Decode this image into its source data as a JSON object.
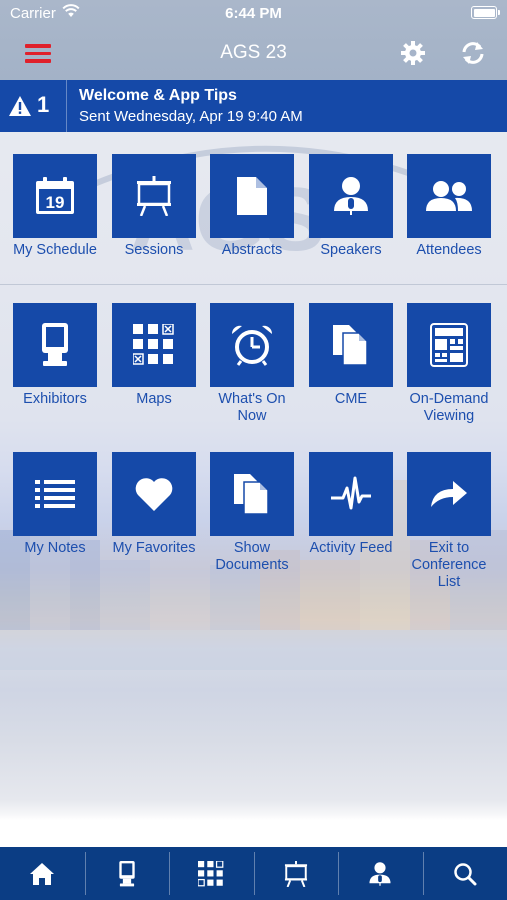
{
  "status_bar": {
    "carrier": "Carrier",
    "time": "6:44 PM"
  },
  "nav": {
    "title": "AGS 23",
    "accent_color": "#e0202b"
  },
  "alert": {
    "count": "1",
    "title": "Welcome & App Tips",
    "subtitle": "Sent Wednesday, Apr 19 9:40 AM",
    "color": "#1549a8"
  },
  "tiles": [
    {
      "label": "My Schedule",
      "icon": "calendar-icon"
    },
    {
      "label": "Sessions",
      "icon": "easel-icon"
    },
    {
      "label": "Abstracts",
      "icon": "document-icon"
    },
    {
      "label": "Speakers",
      "icon": "speaker-icon"
    },
    {
      "label": "Attendees",
      "icon": "people-icon"
    },
    {
      "label": "Exhibitors",
      "icon": "kiosk-icon"
    },
    {
      "label": "Maps",
      "icon": "map-grid-icon"
    },
    {
      "label": "What's On Now",
      "icon": "alarm-clock-icon"
    },
    {
      "label": "CME",
      "icon": "documents-icon"
    },
    {
      "label": "On-Demand Viewing",
      "icon": "on-demand-icon"
    },
    {
      "label": "My Notes",
      "icon": "list-icon"
    },
    {
      "label": "My Favorites",
      "icon": "heart-icon"
    },
    {
      "label": "Show Documents",
      "icon": "documents-icon"
    },
    {
      "label": "Activity Feed",
      "icon": "pulse-icon"
    },
    {
      "label": "Exit to Conference List",
      "icon": "share-arrow-icon"
    }
  ],
  "calendar_day": "19",
  "tab_bar": {
    "items": [
      {
        "icon": "home-icon"
      },
      {
        "icon": "kiosk-icon"
      },
      {
        "icon": "map-grid-icon"
      },
      {
        "icon": "easel-icon"
      },
      {
        "icon": "speaker-icon"
      },
      {
        "icon": "search-icon"
      }
    ],
    "color": "#0b3d84"
  }
}
